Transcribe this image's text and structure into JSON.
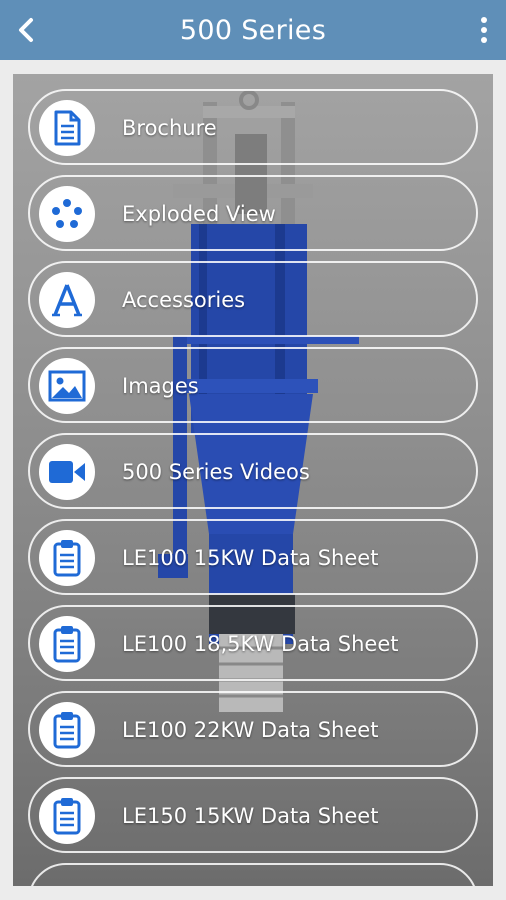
{
  "header": {
    "title": "500 Series",
    "back_icon": "back-chevron-icon",
    "menu_icon": "more-vertical-icon"
  },
  "colors": {
    "appbar": "#5f8fb8",
    "icon_blue": "#1f6ad6",
    "pump_blue": "#2547a8"
  },
  "menu": {
    "items": [
      {
        "label": "Brochure",
        "icon": "document-icon"
      },
      {
        "label": "Exploded View",
        "icon": "exploded-view-icon"
      },
      {
        "label": "Accessories",
        "icon": "letter-a-icon"
      },
      {
        "label": "Images",
        "icon": "image-icon"
      },
      {
        "label": "500 Series Videos",
        "icon": "video-camera-icon"
      },
      {
        "label": "LE100 15KW Data Sheet",
        "icon": "clipboard-icon"
      },
      {
        "label": "LE100 18,5KW Data Sheet",
        "icon": "clipboard-icon"
      },
      {
        "label": "LE100 22KW Data Sheet",
        "icon": "clipboard-icon"
      },
      {
        "label": "LE150 15KW Data Sheet",
        "icon": "clipboard-icon"
      }
    ]
  }
}
